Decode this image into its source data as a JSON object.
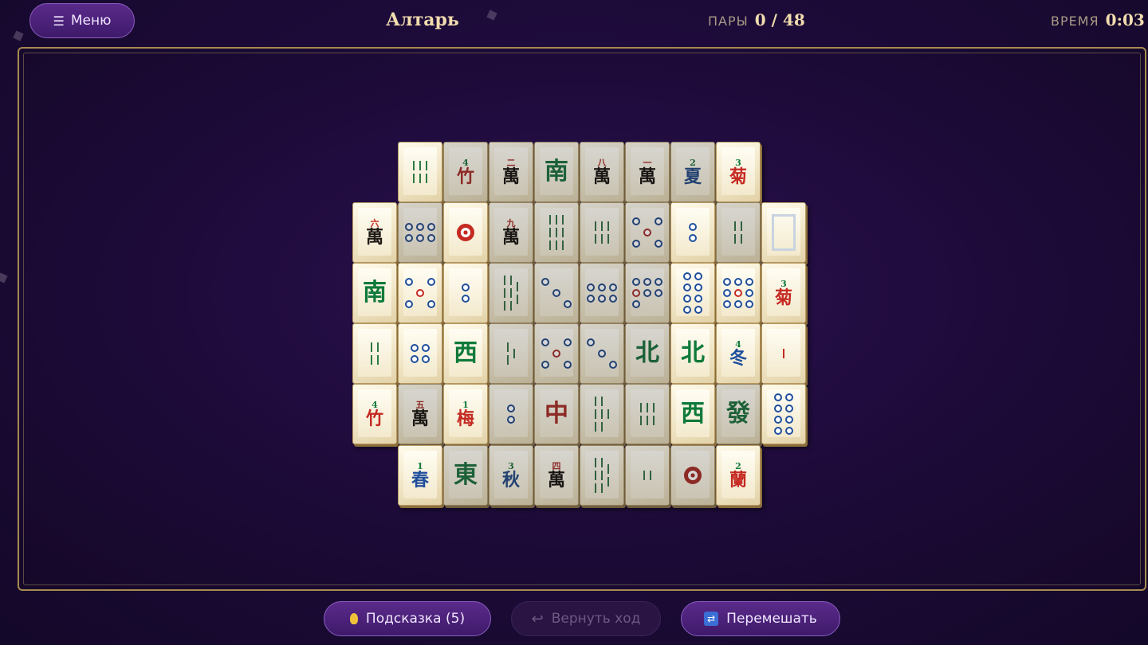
{
  "header": {
    "menu_icon": "☰",
    "menu_label": "Меню",
    "title": "Алтарь",
    "pairs_label": "ПАРЫ",
    "pairs_value": "0 / 48",
    "time_label": "ВРЕМЯ",
    "time_value": "0:03"
  },
  "footer": {
    "hint_label": "Подсказка (5)",
    "undo_icon": "↩",
    "undo_label": "Вернуть ход",
    "shuffle_icon": "⇄",
    "shuffle_label": "Перемешать"
  },
  "tiles": {
    "r0": [
      {
        "type": "bamboo",
        "n": 6
      },
      {
        "type": "flower",
        "num": "4",
        "char": "竹"
      },
      {
        "type": "wan",
        "num": "二"
      },
      {
        "type": "wind",
        "char": "南"
      },
      {
        "type": "wan",
        "num": "八"
      },
      {
        "type": "wan",
        "num": "一"
      },
      {
        "type": "season",
        "num": "2",
        "char": "夏"
      },
      {
        "type": "flower",
        "num": "3",
        "char": "菊"
      }
    ],
    "r1": [
      {
        "type": "wan",
        "num": "六"
      },
      {
        "type": "dots",
        "n": 6
      },
      {
        "type": "dot1"
      },
      {
        "type": "wan",
        "num": "九"
      },
      {
        "type": "bamboo",
        "n": 9
      },
      {
        "type": "bamboo",
        "n": 6
      },
      {
        "type": "dots",
        "n": 5
      },
      {
        "type": "dots",
        "n": 2
      },
      {
        "type": "bamboo",
        "n": 4
      },
      {
        "type": "white"
      }
    ],
    "r2": [
      {
        "type": "wind",
        "char": "南"
      },
      {
        "type": "dots",
        "n": 5
      },
      {
        "type": "dots",
        "n": 2
      },
      {
        "type": "bamboo",
        "n": 8
      },
      {
        "type": "dots",
        "n": 3
      },
      {
        "type": "dots",
        "n": 6
      },
      {
        "type": "dots",
        "n": 7
      },
      {
        "type": "dots",
        "n": 8
      },
      {
        "type": "dots",
        "n": 9
      },
      {
        "type": "flower",
        "num": "3",
        "char": "菊"
      }
    ],
    "r3": [
      {
        "type": "bamboo",
        "n": 4
      },
      {
        "type": "dots",
        "n": 4
      },
      {
        "type": "wind",
        "char": "西"
      },
      {
        "type": "bamboo",
        "n": 3
      },
      {
        "type": "dots",
        "n": 5
      },
      {
        "type": "dots",
        "n": 3
      },
      {
        "type": "wind",
        "char": "北"
      },
      {
        "type": "wind",
        "char": "北"
      },
      {
        "type": "season",
        "num": "4",
        "char": "冬"
      },
      {
        "type": "bamboo",
        "n": 1
      }
    ],
    "r4": [
      {
        "type": "flower",
        "num": "4",
        "char": "竹"
      },
      {
        "type": "wan",
        "num": "五"
      },
      {
        "type": "flower",
        "num": "1",
        "char": "梅"
      },
      {
        "type": "dots",
        "n": 2
      },
      {
        "type": "dragon_red",
        "char": "中"
      },
      {
        "type": "bamboo",
        "n": 7
      },
      {
        "type": "bamboo",
        "n": 6
      },
      {
        "type": "wind",
        "char": "西"
      },
      {
        "type": "dragon_green",
        "char": "發"
      },
      {
        "type": "dots",
        "n": 8
      }
    ],
    "r5": [
      {
        "type": "season",
        "num": "1",
        "char": "春"
      },
      {
        "type": "wind",
        "char": "東"
      },
      {
        "type": "season",
        "num": "3",
        "char": "秋"
      },
      {
        "type": "wan",
        "num": "四"
      },
      {
        "type": "bamboo",
        "n": 8
      },
      {
        "type": "bamboo",
        "n": 2
      },
      {
        "type": "dot1"
      },
      {
        "type": "flower",
        "num": "2",
        "char": "蘭"
      }
    ],
    "wan_char": "萬"
  }
}
